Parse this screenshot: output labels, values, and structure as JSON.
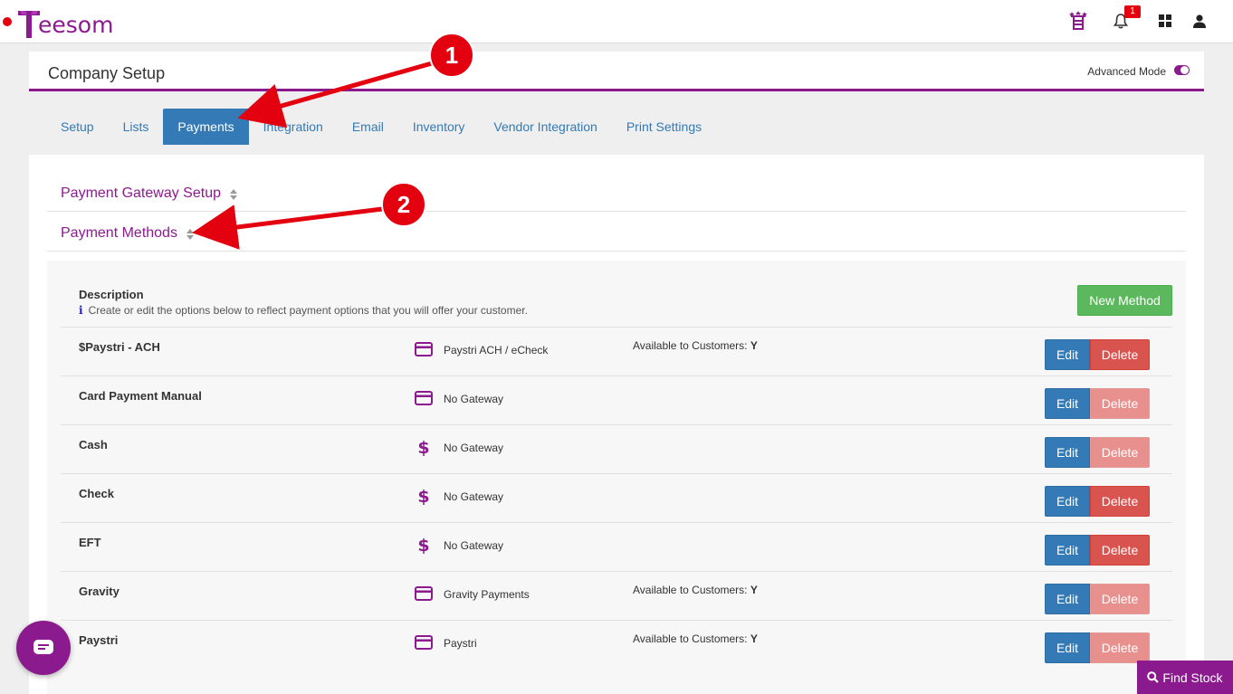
{
  "app": {
    "logo_text": "eesom"
  },
  "topnav": {
    "notification_count": "1"
  },
  "header": {
    "title": "Company Setup",
    "advanced_mode_label": "Advanced Mode"
  },
  "tabs": [
    {
      "label": "Setup"
    },
    {
      "label": "Lists"
    },
    {
      "label": "Payments",
      "active": true
    },
    {
      "label": "Integration"
    },
    {
      "label": "Email"
    },
    {
      "label": "Inventory"
    },
    {
      "label": "Vendor Integration"
    },
    {
      "label": "Print Settings"
    }
  ],
  "sections": {
    "gateway_setup": "Payment Gateway Setup",
    "payment_methods": "Payment Methods"
  },
  "methods_panel": {
    "description_label": "Description",
    "description_note": "Create or edit the options below to reflect payment options that you will offer your customer.",
    "new_button": "New Method",
    "edit_label": "Edit",
    "delete_label": "Delete",
    "available_label": "Available to Customers:",
    "rows": [
      {
        "name": "$Paystri - ACH",
        "icon": "credit-card-icon",
        "gateway": "Paystri ACH / eCheck",
        "available": "Y",
        "delete_enabled": true
      },
      {
        "name": "Card Payment Manual",
        "icon": "credit-card-icon",
        "gateway": "No Gateway",
        "available": "",
        "delete_enabled": false
      },
      {
        "name": "Cash",
        "icon": "dollar-icon",
        "gateway": "No Gateway",
        "available": "",
        "delete_enabled": false
      },
      {
        "name": "Check",
        "icon": "dollar-icon",
        "gateway": "No Gateway",
        "available": "",
        "delete_enabled": true
      },
      {
        "name": "EFT",
        "icon": "dollar-icon",
        "gateway": "No Gateway",
        "available": "",
        "delete_enabled": true
      },
      {
        "name": "Gravity",
        "icon": "credit-card-icon",
        "gateway": "Gravity Payments",
        "available": "Y",
        "delete_enabled": false
      },
      {
        "name": "Paystri",
        "icon": "credit-card-icon",
        "gateway": "Paystri",
        "available": "Y",
        "delete_enabled": false
      }
    ]
  },
  "annotations": [
    "1",
    "2"
  ],
  "find_stock": {
    "label": "Find Stock"
  },
  "colors": {
    "brand": "#8c1a8f",
    "primary": "#337ab7",
    "success": "#5cb85c",
    "danger": "#d9534f",
    "annotation": "#e3000f"
  }
}
